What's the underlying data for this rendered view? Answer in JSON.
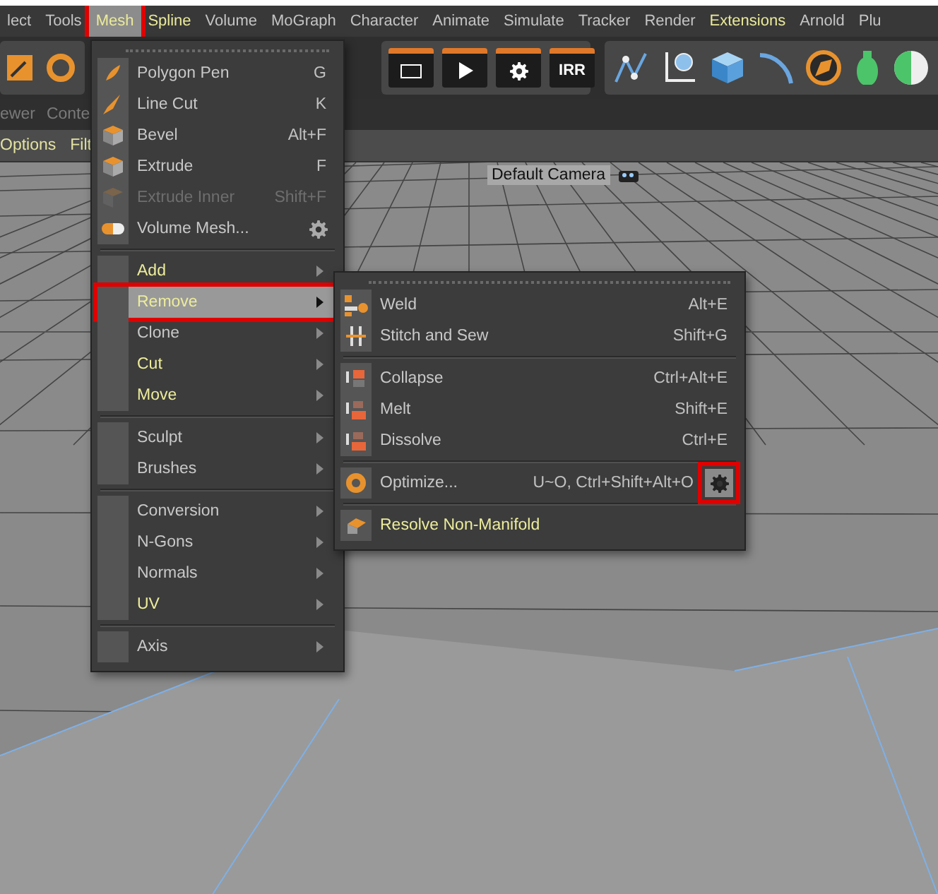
{
  "menu_bar": [
    {
      "label": "lect",
      "selected": false,
      "accent": false,
      "annotated": false
    },
    {
      "label": "Tools",
      "selected": false,
      "accent": false,
      "annotated": false
    },
    {
      "label": "Mesh",
      "selected": true,
      "accent": true,
      "annotated": true
    },
    {
      "label": "Spline",
      "selected": false,
      "accent": true,
      "annotated": false
    },
    {
      "label": "Volume",
      "selected": false,
      "accent": false,
      "annotated": false
    },
    {
      "label": "MoGraph",
      "selected": false,
      "accent": false,
      "annotated": false
    },
    {
      "label": "Character",
      "selected": false,
      "accent": false,
      "annotated": false
    },
    {
      "label": "Animate",
      "selected": false,
      "accent": false,
      "annotated": false
    },
    {
      "label": "Simulate",
      "selected": false,
      "accent": false,
      "annotated": false
    },
    {
      "label": "Tracker",
      "selected": false,
      "accent": false,
      "annotated": false
    },
    {
      "label": "Render",
      "selected": false,
      "accent": false,
      "annotated": false
    },
    {
      "label": "Extensions",
      "selected": false,
      "accent": true,
      "annotated": false
    },
    {
      "label": "Arnold",
      "selected": false,
      "accent": false,
      "annotated": false
    },
    {
      "label": "Plu",
      "selected": false,
      "accent": false,
      "annotated": false
    }
  ],
  "toolbar": {
    "render_label": "IRR"
  },
  "panel_tabs": [
    "ewer",
    "Conte"
  ],
  "options_bar": [
    "Options",
    "Filt"
  ],
  "viewport": {
    "camera_label": "Default Camera"
  },
  "mesh_menu": {
    "groups": [
      [
        {
          "kind": "command",
          "label": "Polygon Pen",
          "shortcut": "G",
          "disabled": false,
          "accent": false,
          "selected": false,
          "settings": false,
          "annotated": false
        },
        {
          "kind": "command",
          "label": "Line Cut",
          "shortcut": "K",
          "disabled": false,
          "accent": false,
          "selected": false,
          "settings": false,
          "annotated": false
        },
        {
          "kind": "command",
          "label": "Bevel",
          "shortcut": "Alt+F",
          "disabled": false,
          "accent": false,
          "selected": false,
          "settings": false,
          "annotated": false
        },
        {
          "kind": "command",
          "label": "Extrude",
          "shortcut": "F",
          "disabled": false,
          "accent": false,
          "selected": false,
          "settings": false,
          "annotated": false
        },
        {
          "kind": "command",
          "label": "Extrude Inner",
          "shortcut": "Shift+F",
          "disabled": true,
          "accent": false,
          "selected": false,
          "settings": false,
          "annotated": false
        },
        {
          "kind": "command",
          "label": "Volume Mesh...",
          "disabled": false,
          "accent": false,
          "selected": false,
          "settings": true,
          "annotated": false
        }
      ],
      [
        {
          "kind": "submenu",
          "label": "Add",
          "disabled": false,
          "accent": true,
          "selected": false,
          "settings": false,
          "annotated": false
        },
        {
          "kind": "submenu",
          "label": "Remove",
          "disabled": false,
          "accent": true,
          "selected": true,
          "settings": false,
          "annotated": true
        },
        {
          "kind": "submenu",
          "label": "Clone",
          "disabled": false,
          "accent": false,
          "selected": false,
          "settings": false,
          "annotated": false
        },
        {
          "kind": "submenu",
          "label": "Cut",
          "disabled": false,
          "accent": true,
          "selected": false,
          "settings": false,
          "annotated": false
        },
        {
          "kind": "submenu",
          "label": "Move",
          "disabled": false,
          "accent": true,
          "selected": false,
          "settings": false,
          "annotated": false
        }
      ],
      [
        {
          "kind": "submenu",
          "label": "Sculpt",
          "disabled": false,
          "accent": false,
          "selected": false,
          "settings": false,
          "annotated": false
        },
        {
          "kind": "submenu",
          "label": "Brushes",
          "disabled": false,
          "accent": false,
          "selected": false,
          "settings": false,
          "annotated": false
        }
      ],
      [
        {
          "kind": "submenu",
          "label": "Conversion",
          "disabled": false,
          "accent": false,
          "selected": false,
          "settings": false,
          "annotated": false
        },
        {
          "kind": "submenu",
          "label": "N-Gons",
          "disabled": false,
          "accent": false,
          "selected": false,
          "settings": false,
          "annotated": false
        },
        {
          "kind": "submenu",
          "label": "Normals",
          "disabled": false,
          "accent": false,
          "selected": false,
          "settings": false,
          "annotated": false
        },
        {
          "kind": "submenu",
          "label": "UV",
          "disabled": false,
          "accent": true,
          "selected": false,
          "settings": false,
          "annotated": false
        }
      ],
      [
        {
          "kind": "submenu",
          "label": "Axis",
          "disabled": false,
          "accent": false,
          "selected": false,
          "settings": false,
          "annotated": false
        }
      ]
    ]
  },
  "remove_menu": {
    "groups": [
      [
        {
          "kind": "command",
          "label": "Weld",
          "shortcut": "Alt+E",
          "disabled": false,
          "accent": false,
          "selected": false,
          "settings": false,
          "annotated": false
        },
        {
          "kind": "command",
          "label": "Stitch and Sew",
          "shortcut": "Shift+G",
          "disabled": false,
          "accent": false,
          "selected": false,
          "settings": false,
          "annotated": false
        }
      ],
      [
        {
          "kind": "command",
          "label": "Collapse",
          "shortcut": "Ctrl+Alt+E",
          "disabled": false,
          "accent": false,
          "selected": false,
          "settings": false,
          "annotated": false
        },
        {
          "kind": "command",
          "label": "Melt",
          "shortcut": "Shift+E",
          "disabled": false,
          "accent": false,
          "selected": false,
          "settings": false,
          "annotated": false
        },
        {
          "kind": "command",
          "label": "Dissolve",
          "shortcut": "Ctrl+E",
          "disabled": false,
          "accent": false,
          "selected": false,
          "settings": false,
          "annotated": false
        }
      ],
      [
        {
          "kind": "command",
          "label": "Optimize...",
          "shortcut": "U~O, Ctrl+Shift+Alt+O",
          "disabled": false,
          "accent": false,
          "selected": false,
          "settings": true,
          "annotated": true
        }
      ],
      [
        {
          "kind": "command",
          "label": "Resolve Non-Manifold",
          "disabled": false,
          "accent": true,
          "selected": false,
          "settings": false,
          "annotated": false
        }
      ]
    ]
  }
}
